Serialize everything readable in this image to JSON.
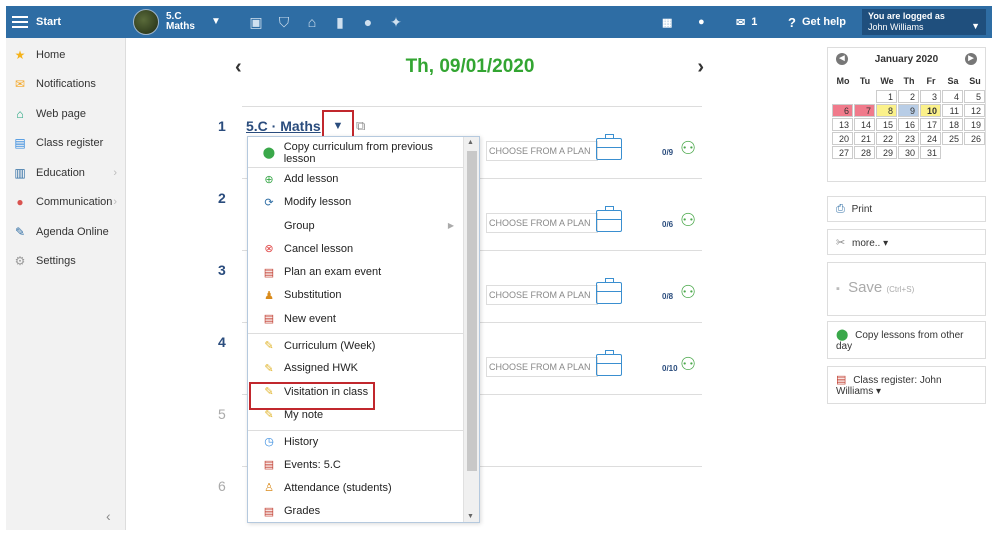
{
  "topbar": {
    "start_label": "Start",
    "class_line1": "5.C",
    "class_line2": "Maths",
    "icons": [
      "briefcase-icon",
      "shield-icon",
      "institution-icon",
      "bar-chart-icon",
      "badge-icon",
      "people-icon"
    ],
    "messages_count": "1",
    "help_label": "Get help",
    "logged_label": "You are logged as",
    "user_name": "John Williams"
  },
  "sidebar": {
    "items": [
      {
        "label": "Home",
        "icon": "star-icon",
        "color": "#f5b21a"
      },
      {
        "label": "Notifications",
        "icon": "envelope-icon",
        "color": "#f5a623"
      },
      {
        "label": "Web page",
        "icon": "house-icon",
        "color": "#1aa27a"
      },
      {
        "label": "Class register",
        "icon": "register-icon",
        "color": "#2e86de"
      },
      {
        "label": "Education",
        "icon": "book-icon",
        "color": "#2e6da4"
      },
      {
        "label": "Communication",
        "icon": "chat-icon",
        "color": "#d9534f"
      },
      {
        "label": "Agenda Online",
        "icon": "pen-icon",
        "color": "#2e6da4"
      },
      {
        "label": "Settings",
        "icon": "gear-icon",
        "color": "#999"
      }
    ]
  },
  "main": {
    "date": "Th, 09/01/2020",
    "lesson_title": "5.C · Maths",
    "lessons": [
      {
        "num": "1",
        "plan_placeholder": "CHOOSE FROM A PLAN",
        "attendance": "0/9"
      },
      {
        "num": "2",
        "plan_placeholder": "CHOOSE FROM A PLAN",
        "attendance": "0/6"
      },
      {
        "num": "3",
        "plan_placeholder": "CHOOSE FROM A PLAN",
        "attendance": "0/8"
      },
      {
        "num": "4",
        "plan_placeholder": "CHOOSE FROM A PLAN",
        "attendance": "0/10"
      },
      {
        "num": "5"
      },
      {
        "num": "6"
      }
    ]
  },
  "menu": {
    "items": [
      {
        "label": "Copy curriculum from previous lesson",
        "icon": "copy-icon"
      },
      {
        "label": "Add lesson",
        "icon": "plus-circle-icon",
        "sep": true
      },
      {
        "label": "Modify lesson",
        "icon": "refresh-icon"
      },
      {
        "label": "Group",
        "icon": "",
        "submenu": true
      },
      {
        "label": "Cancel lesson",
        "icon": "cancel-icon"
      },
      {
        "label": "Plan an exam event",
        "icon": "exam-icon"
      },
      {
        "label": "Substitution",
        "icon": "substitution-icon"
      },
      {
        "label": "New event",
        "icon": "event-icon"
      },
      {
        "label": "Curriculum (Week)",
        "icon": "pencil-icon",
        "sep": true
      },
      {
        "label": "Assigned HWK",
        "icon": "pencil-icon"
      },
      {
        "label": "Visitation in class",
        "icon": "pencil-icon"
      },
      {
        "label": "My note",
        "icon": "pencil-icon"
      },
      {
        "label": "History",
        "icon": "clock-icon",
        "sep": true
      },
      {
        "label": "Events: 5.C",
        "icon": "event-icon"
      },
      {
        "label": "Attendance (students)",
        "icon": "person-icon"
      },
      {
        "label": "Grades",
        "icon": "grades-icon"
      }
    ]
  },
  "calendar": {
    "month": "January 2020",
    "weekdays": [
      "Mo",
      "Tu",
      "We",
      "Th",
      "Fr",
      "Sa",
      "Su"
    ],
    "days": [
      {
        "d": ""
      },
      {
        "d": ""
      },
      {
        "d": "1"
      },
      {
        "d": "2"
      },
      {
        "d": "3"
      },
      {
        "d": "4"
      },
      {
        "d": "5"
      },
      {
        "d": "6",
        "c": "red"
      },
      {
        "d": "7",
        "c": "red"
      },
      {
        "d": "8",
        "c": "yellow"
      },
      {
        "d": "9",
        "c": "sel"
      },
      {
        "d": "10",
        "c": "today"
      },
      {
        "d": "11"
      },
      {
        "d": "12"
      },
      {
        "d": "13"
      },
      {
        "d": "14"
      },
      {
        "d": "15"
      },
      {
        "d": "16"
      },
      {
        "d": "17"
      },
      {
        "d": "18"
      },
      {
        "d": "19"
      },
      {
        "d": "20"
      },
      {
        "d": "21"
      },
      {
        "d": "22"
      },
      {
        "d": "23"
      },
      {
        "d": "24"
      },
      {
        "d": "25"
      },
      {
        "d": "26"
      },
      {
        "d": "27"
      },
      {
        "d": "28"
      },
      {
        "d": "29"
      },
      {
        "d": "30"
      },
      {
        "d": "31"
      },
      {
        "d": ""
      },
      {
        "d": ""
      }
    ]
  },
  "right": {
    "print": "Print",
    "more": "more.. ▾",
    "save": "Save",
    "save_hint": "(Ctrl+S)",
    "copy_lessons": "Copy lessons from other day",
    "class_register": "Class register: John Williams ▾"
  }
}
